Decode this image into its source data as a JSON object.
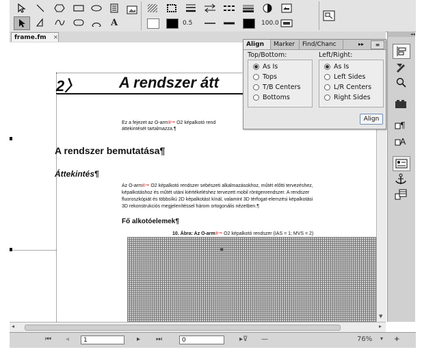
{
  "toolbar": {
    "tools": [
      "select-arrow-tool",
      "line-tool",
      "polygon-tool",
      "rectangle-tool",
      "oval-tool",
      "text-frame-tool",
      "graphic-frame-tool",
      "pointer-tool",
      "polyline-tool",
      "freehand-tool",
      "rounded-rect-tool",
      "arc-tool",
      "text-tool"
    ],
    "stroke_width": "0.5",
    "tint": "100.0",
    "colors": {
      "fill": "#ffffff",
      "stroke": "#000000"
    }
  },
  "tab": {
    "label": "frame.fm",
    "close": "×"
  },
  "document": {
    "chapter_number": "2〉",
    "chapter_title": "A rendszer átt",
    "intro_line1": "Ez a fejezet az O-arm",
    "intro_line1b": "O2 képalkotó rend",
    "intro_line2": "áttekintését tartalmazza.¶",
    "heading1": "A rendszer bemutatása¶",
    "heading2": "Áttekintés¶",
    "para_lines": [
      "Az O-arm",
      "O2 képalkotó rendszer sebészeti alkalmazásokhoz, műtét előtti tervezéshez,",
      "képalkotáshoz és műtét utáni kiértékeléshez tervezett mobil röntgenrendszer. A rendszer",
      "fluoroszkópiát és többsíkú 2D képalkotást kínál, valamint 3D térfogat-elemzési képalkotási",
      "3D rekonstrukciós megjelenítéssel három ortogonális nézetben.¶"
    ],
    "heading3": "Fő alkotóelemek¶",
    "caption": "10. Ábra: Az O-arm",
    "caption_rest": "O2 képalkotó  rendszer (IAS = 1; MVS = 2)",
    "anchor_mark": "¤"
  },
  "align_panel": {
    "tabs": [
      "Align",
      "Marker",
      "Find/Chanc"
    ],
    "top_bottom_label": "Top/Bottom:",
    "left_right_label": "Left/Right:",
    "top_bottom_options": [
      "As Is",
      "Tops",
      "T/B Centers",
      "Bottoms"
    ],
    "left_right_options": [
      "As Is",
      "Left Sides",
      "L/R Centers",
      "Right Sides"
    ],
    "top_bottom_selected": 0,
    "left_right_selected": 0,
    "align_button": "Align",
    "overflow": "▸▸",
    "menu": "≡"
  },
  "statusbar": {
    "page_number": "1",
    "goto_value": "0",
    "zoom": "76%",
    "zoom_out": "—",
    "zoom_in": "+"
  }
}
